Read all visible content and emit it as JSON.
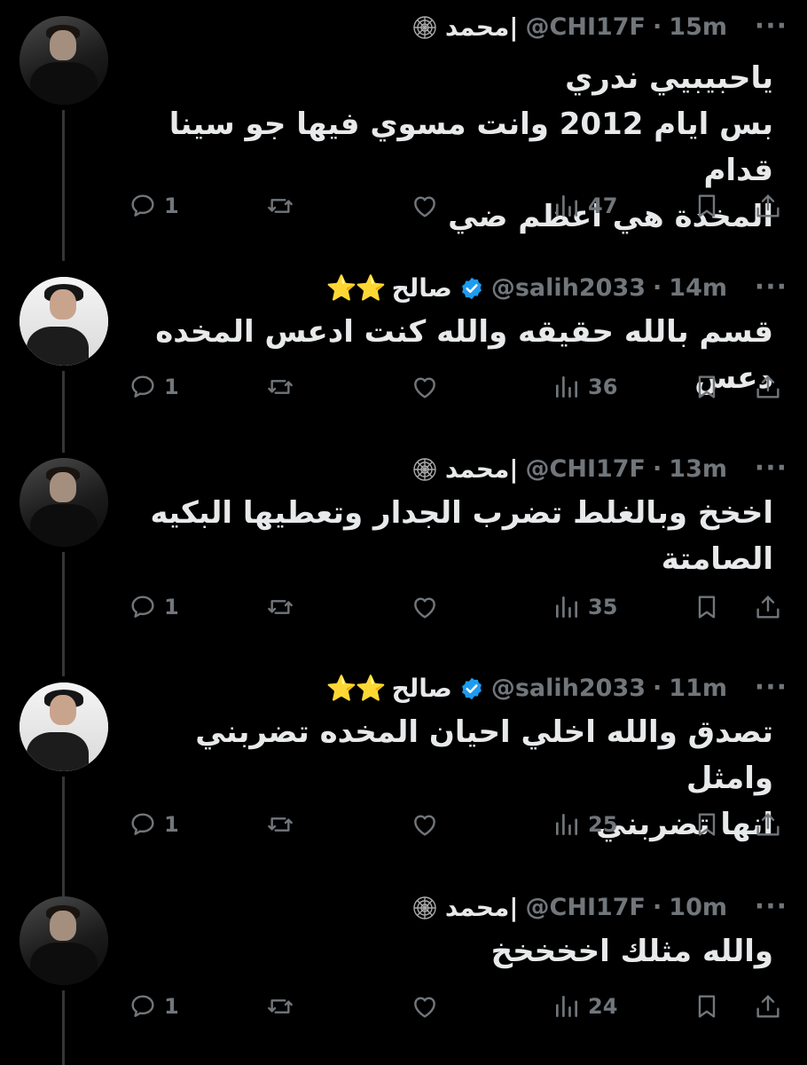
{
  "tweets": [
    {
      "name": "محمد|",
      "handle": "@CHI17F",
      "time": "15m",
      "badge": "web-icon",
      "text": "ياحبيبيي ندري\nبس ايام 2012 وانت مسوي فيها جو سينا قدام\nالمخدة هي اعظم ضي",
      "replies": "1",
      "views": "47"
    },
    {
      "name": "صالح",
      "handle": "@salih2033",
      "time": "14m",
      "badge": "verified-icon",
      "stars": "⭐⭐",
      "text": "قسم بالله حقيقه والله كنت ادعس المخده دعس",
      "replies": "1",
      "views": "36"
    },
    {
      "name": "محمد|",
      "handle": "@CHI17F",
      "time": "13m",
      "badge": "web-icon",
      "text": "اخخخ وبالغلط تضرب الجدار وتعطيها البكيه\nالصامتة",
      "replies": "1",
      "views": "35"
    },
    {
      "name": "صالح",
      "handle": "@salih2033",
      "time": "11m",
      "badge": "verified-icon",
      "stars": "⭐⭐",
      "text": "تصدق والله اخلي احيان المخده تضربني وامثل\nانها تضربني",
      "replies": "1",
      "views": "25"
    },
    {
      "name": "محمد|",
      "handle": "@CHI17F",
      "time": "10m",
      "badge": "web-icon",
      "text": "والله مثلك اخخخخخ",
      "replies": "1",
      "views": "24"
    }
  ],
  "ui": {
    "separator": "·",
    "more": "···"
  },
  "colors": {
    "background": "#000000",
    "text": "#e7e9ea",
    "muted": "#71767b",
    "verified": "#1d9bf0",
    "stars": "#f5c518"
  }
}
